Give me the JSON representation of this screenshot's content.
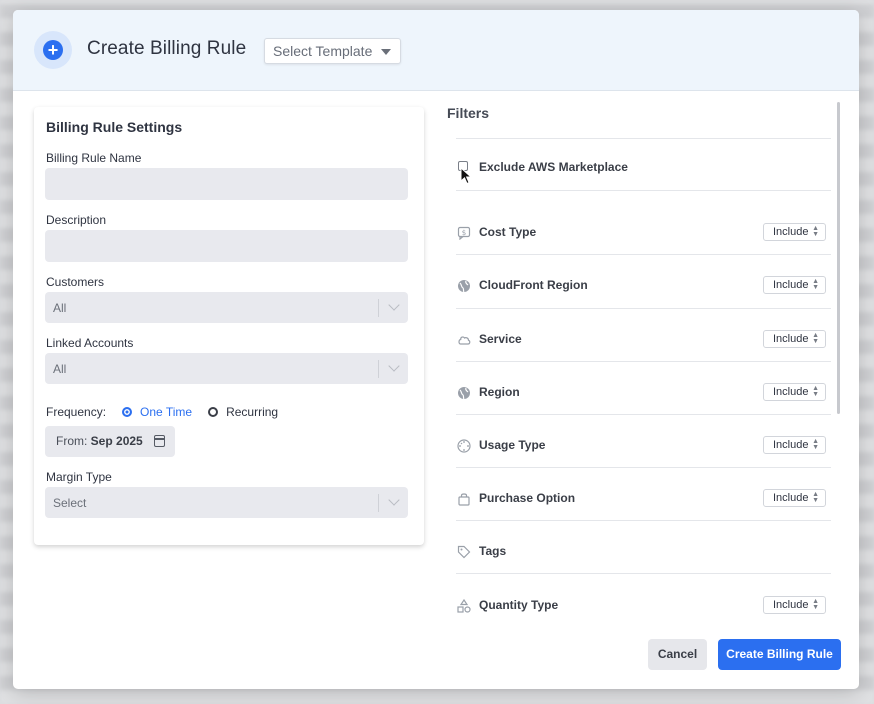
{
  "header": {
    "title": "Create Billing Rule",
    "template_placeholder": "Select Template",
    "icon": "plus-circle-icon"
  },
  "settings": {
    "heading": "Billing Rule Settings",
    "name_label": "Billing Rule Name",
    "name_value": "",
    "description_label": "Description",
    "description_value": "",
    "customers_label": "Customers",
    "customers_value": "All",
    "linked_accounts_label": "Linked Accounts",
    "linked_accounts_value": "All",
    "frequency_label": "Frequency:",
    "frequency_options": [
      "One Time",
      "Recurring"
    ],
    "frequency_selected": "One Time",
    "from_label": "From:",
    "from_value": "Sep 2025",
    "margin_type_label": "Margin Type",
    "margin_type_value": "Select"
  },
  "filters": {
    "title": "Filters",
    "exclude_marketplace_label": "Exclude AWS Marketplace",
    "exclude_marketplace_checked": false,
    "items": [
      {
        "label": "Cost Type",
        "icon": "cost-tag-icon",
        "mode": "Include"
      },
      {
        "label": "CloudFront Region",
        "icon": "globe-icon",
        "mode": "Include"
      },
      {
        "label": "Service",
        "icon": "cloud-icon",
        "mode": "Include"
      },
      {
        "label": "Region",
        "icon": "globe-icon",
        "mode": "Include"
      },
      {
        "label": "Usage Type",
        "icon": "usage-dial-icon",
        "mode": "Include"
      },
      {
        "label": "Purchase Option",
        "icon": "shopping-bag-icon",
        "mode": "Include"
      },
      {
        "label": "Tags",
        "icon": "tag-icon",
        "mode": ""
      },
      {
        "label": "Quantity Type",
        "icon": "shapes-icon",
        "mode": "Include"
      }
    ]
  },
  "footer": {
    "cancel_label": "Cancel",
    "create_label": "Create Billing Rule"
  },
  "colors": {
    "accent": "#2b6ff0",
    "header_bg": "#eef5fc",
    "input_bg": "#e8e9ee"
  }
}
